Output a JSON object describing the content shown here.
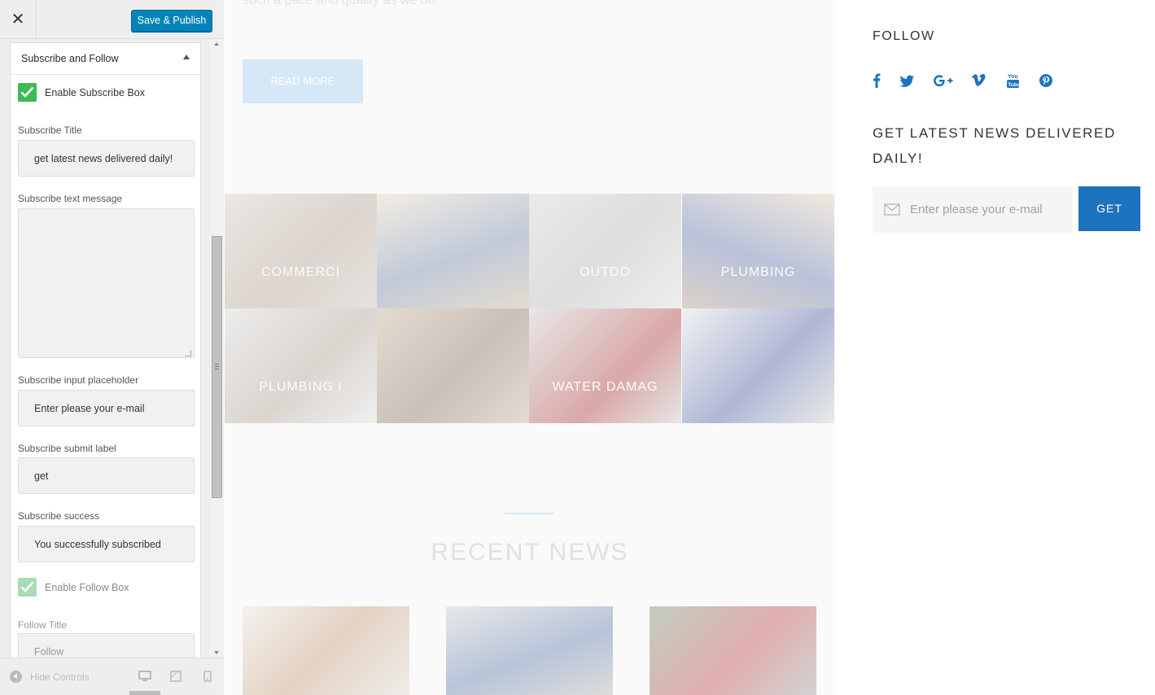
{
  "customizer": {
    "close_glyph": "✕",
    "publish_label": "Save & Publish",
    "section_title": "Subscribe and Follow",
    "enable_subscribe_label": "Enable Subscribe Box",
    "enable_subscribe_checked": true,
    "subscribe_title_label": "Subscribe Title",
    "subscribe_title_value": "get latest news delivered daily!",
    "subscribe_text_label": "Subscribe text message",
    "subscribe_text_value": "",
    "subscribe_placeholder_label": "Subscribe input placeholder",
    "subscribe_placeholder_value": "Enter please your e-mail",
    "subscribe_submit_label": "Subscribe submit label",
    "subscribe_submit_value": "get",
    "subscribe_success_label": "Subscribe success",
    "subscribe_success_value": "You successfully subscribed",
    "enable_follow_label": "Enable Follow Box",
    "enable_follow_checked": true,
    "follow_title_label": "Follow Title",
    "follow_title_value": "Follow",
    "hide_controls_label": "Hide Controls",
    "devices": [
      "desktop-icon",
      "tablet-icon",
      "mobile-icon"
    ],
    "check_color": "#3cba54",
    "publish_color": "#0085ba"
  },
  "preview": {
    "truncated_text": "such a pace and quality as we do!",
    "read_more_label": "READ MORE",
    "gallery": [
      {
        "label": "COMMERCI"
      },
      {
        "label": ""
      },
      {
        "label": "OUTDO"
      },
      {
        "label": "PLUMBING"
      },
      {
        "label": "PLUMBING I"
      },
      {
        "label": ""
      },
      {
        "label": "WATER DAMAG"
      },
      {
        "label": ""
      }
    ],
    "news_heading": "RECENT NEWS",
    "accent_color": "#1e73be"
  },
  "widget": {
    "follow_title": "FOLLOW",
    "social_icons": [
      "facebook-icon",
      "twitter-icon",
      "google-plus-icon",
      "vimeo-icon",
      "youtube-icon",
      "pinterest-icon"
    ],
    "subscribe_title": "GET LATEST NEWS DELIVERED DAILY!",
    "email_placeholder": "Enter please your e-mail",
    "submit_label": "GET"
  }
}
